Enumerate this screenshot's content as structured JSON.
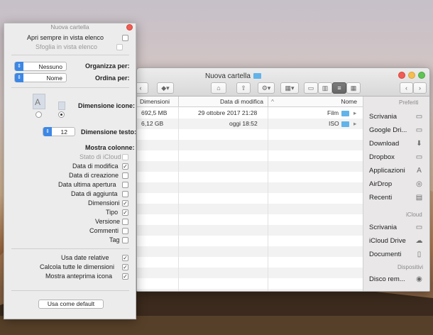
{
  "finder": {
    "title": "Nuova cartella",
    "columns": {
      "name": "Nome",
      "modified": "Data di modifica",
      "size": "Dimensioni"
    },
    "files": [
      {
        "name": "Film",
        "modified": "29 ottobre 2017 21:28",
        "size": "692,5 MB"
      },
      {
        "name": "ISO",
        "modified": "oggi 18:52",
        "size": "6,12 GB"
      }
    ],
    "sidebar": {
      "favorites_header": "Preferiti",
      "favorites": [
        "Scrivania",
        "Google Dri...",
        "Download",
        "Dropbox",
        "Applicazioni",
        "AirDrop",
        "Recenti"
      ],
      "icloud_header": "iCloud",
      "icloud": [
        "Scrivania",
        "iCloud Drive",
        "Documenti"
      ],
      "devices_header": "Dispositivi",
      "devices": [
        "Disco rem..."
      ]
    },
    "colors": {
      "folder": "#62b3e9",
      "close": "#ef5d54",
      "minimize": "#f6be4f",
      "zoom": "#5fc454"
    }
  },
  "panel": {
    "title": "Nuova cartella",
    "always_open_list": "Apri sempre in vista elenco",
    "browse_list": "Sfoglia in vista elenco",
    "arrange_label": "Organizza per:",
    "arrange_value": "Nessuno",
    "sort_label": "Ordina per:",
    "sort_value": "Nome",
    "icon_size_label": "Dimensione icone:",
    "text_size_label": "Dimensione testo:",
    "text_size_value": "12",
    "show_columns_label": "Mostra colonne:",
    "columns": [
      {
        "label": "Stato di iCloud",
        "checked": false,
        "disabled": true
      },
      {
        "label": "Data di modifica",
        "checked": true
      },
      {
        "label": "Data di creazione",
        "checked": false
      },
      {
        "label": "Data ultima apertura",
        "checked": false
      },
      {
        "label": "Data di aggiunta",
        "checked": false
      },
      {
        "label": "Dimensioni",
        "checked": true
      },
      {
        "label": "Tipo",
        "checked": true
      },
      {
        "label": "Versione",
        "checked": false
      },
      {
        "label": "Commenti",
        "checked": false
      },
      {
        "label": "Tag",
        "checked": false
      }
    ],
    "options": [
      {
        "label": "Usa date relative",
        "checked": true
      },
      {
        "label": "Calcola tutte le dimensioni",
        "checked": true
      },
      {
        "label": "Mostra anteprima icona",
        "checked": true
      }
    ],
    "default_button": "Usa come default"
  }
}
